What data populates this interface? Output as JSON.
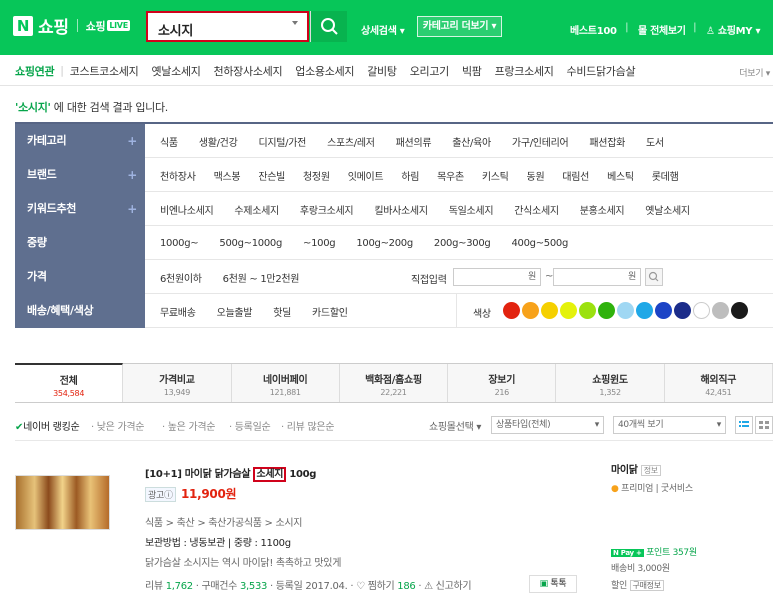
{
  "header": {
    "logo_n": "N",
    "logo_text": "쇼핑",
    "live_text": "쇼핑",
    "live_badge": "LIVE",
    "search_value": "소시지",
    "detail_search": "상세검색",
    "category_more": "카테고리 더보기",
    "best100": "베스트100",
    "all_view": "몰 전체보기",
    "my": "쇼핑MY"
  },
  "related": {
    "title": "쇼핑연관",
    "items": [
      "코스트코소세지",
      "옛날소세지",
      "천하장사소세지",
      "업소용소세지",
      "갈비탕",
      "오리고기",
      "빅팜",
      "프랑크소세지",
      "수비드닭가슴살"
    ],
    "more": "더보기"
  },
  "result_msg": {
    "keyword": "'소시지'",
    "text": " 에 대한 검색 결과 입니다."
  },
  "filters": {
    "category": {
      "label": "카테고리",
      "items": [
        "식품",
        "생활/건강",
        "디지털/가전",
        "스포츠/레저",
        "패션의류",
        "출산/육아",
        "가구/인테리어",
        "패션잡화",
        "도서"
      ]
    },
    "brand": {
      "label": "브랜드",
      "items": [
        "천하장사",
        "맥스봉",
        "잔슨빌",
        "청정원",
        "잇메이트",
        "하림",
        "목우촌",
        "키스틱",
        "동원",
        "대림선",
        "베스틱",
        "롯데햄"
      ]
    },
    "keyword": {
      "label": "키워드추천",
      "items": [
        "비엔나소세지",
        "수제소세지",
        "후랑크소세지",
        "킬바사소세지",
        "독일소세지",
        "간식소세지",
        "분홍소세지",
        "옛날소세지"
      ]
    },
    "weight": {
      "label": "중량",
      "items": [
        "1000g~",
        "500g~1000g",
        "~100g",
        "100g~200g",
        "200g~300g",
        "400g~500g"
      ]
    },
    "price": {
      "label": "가격",
      "items": [
        "6천원이하",
        "6천원 ~ 1만2천원"
      ],
      "direct": "직접입력",
      "won": "원",
      "tilde": "~"
    },
    "delivery": {
      "label": "배송/혜택/색상",
      "items": [
        "무료배송",
        "오늘출발",
        "핫딜",
        "카드할인"
      ],
      "color_label": "색상"
    }
  },
  "colors": [
    "#e2230f",
    "#f7a21b",
    "#f5d000",
    "#e4f20b",
    "#9be10f",
    "#2fb20c",
    "#9fd7f3",
    "#1fa8e7",
    "#1c44c6",
    "#1b2c8a",
    "#ffffff",
    "#bdbdbd",
    "#1a1a1a"
  ],
  "tabs": [
    {
      "name": "전체",
      "count": "354,584"
    },
    {
      "name": "가격비교",
      "count": "13,949"
    },
    {
      "name": "네이버페이",
      "count": "121,881"
    },
    {
      "name": "백화점/홈쇼핑",
      "count": "22,221"
    },
    {
      "name": "장보기",
      "count": "216"
    },
    {
      "name": "쇼핑윈도",
      "count": "1,352"
    },
    {
      "name": "해외직구",
      "count": "42,451"
    }
  ],
  "sort": {
    "items": [
      "네이버 랭킹순",
      "낮은 가격순",
      "높은 가격순",
      "등록일순",
      "리뷰 많은순"
    ],
    "mall_select": "쇼핑몰선택",
    "product_type": "상품타입(전체)",
    "per_page": "40개씩 보기"
  },
  "product": {
    "title_pre": "[10+1] 마이닭 닭가슴살 ",
    "title_hl": "소세지",
    "title_post": " 100g",
    "ad": "광고ⓘ",
    "price": "11,900원",
    "cat": "식품 > 축산 > 축산가공식품 > 소시지",
    "spec": "보관방법 : 냉동보관 | 중량 : 1100g",
    "desc": "닭가슴살 소시지는 역시 마이닭! 촉촉하고 맛있게",
    "meta_review": "리뷰",
    "review_count": "1,762",
    "meta_buy": "구매건수",
    "buy_count": "3,533",
    "meta_date": "등록일 2017.04.",
    "meta_zzim": "찜하기",
    "zzim_count": "186",
    "meta_report": "신고하기",
    "talk": "톡톡",
    "store": "마이닭",
    "store_tag": "정보",
    "premium": "프리미엄 | 굿서비스",
    "npay_point": "포인트 357원",
    "ship": "배송비 3,000원",
    "discount": "할인",
    "discount_tag": "구매정보"
  }
}
